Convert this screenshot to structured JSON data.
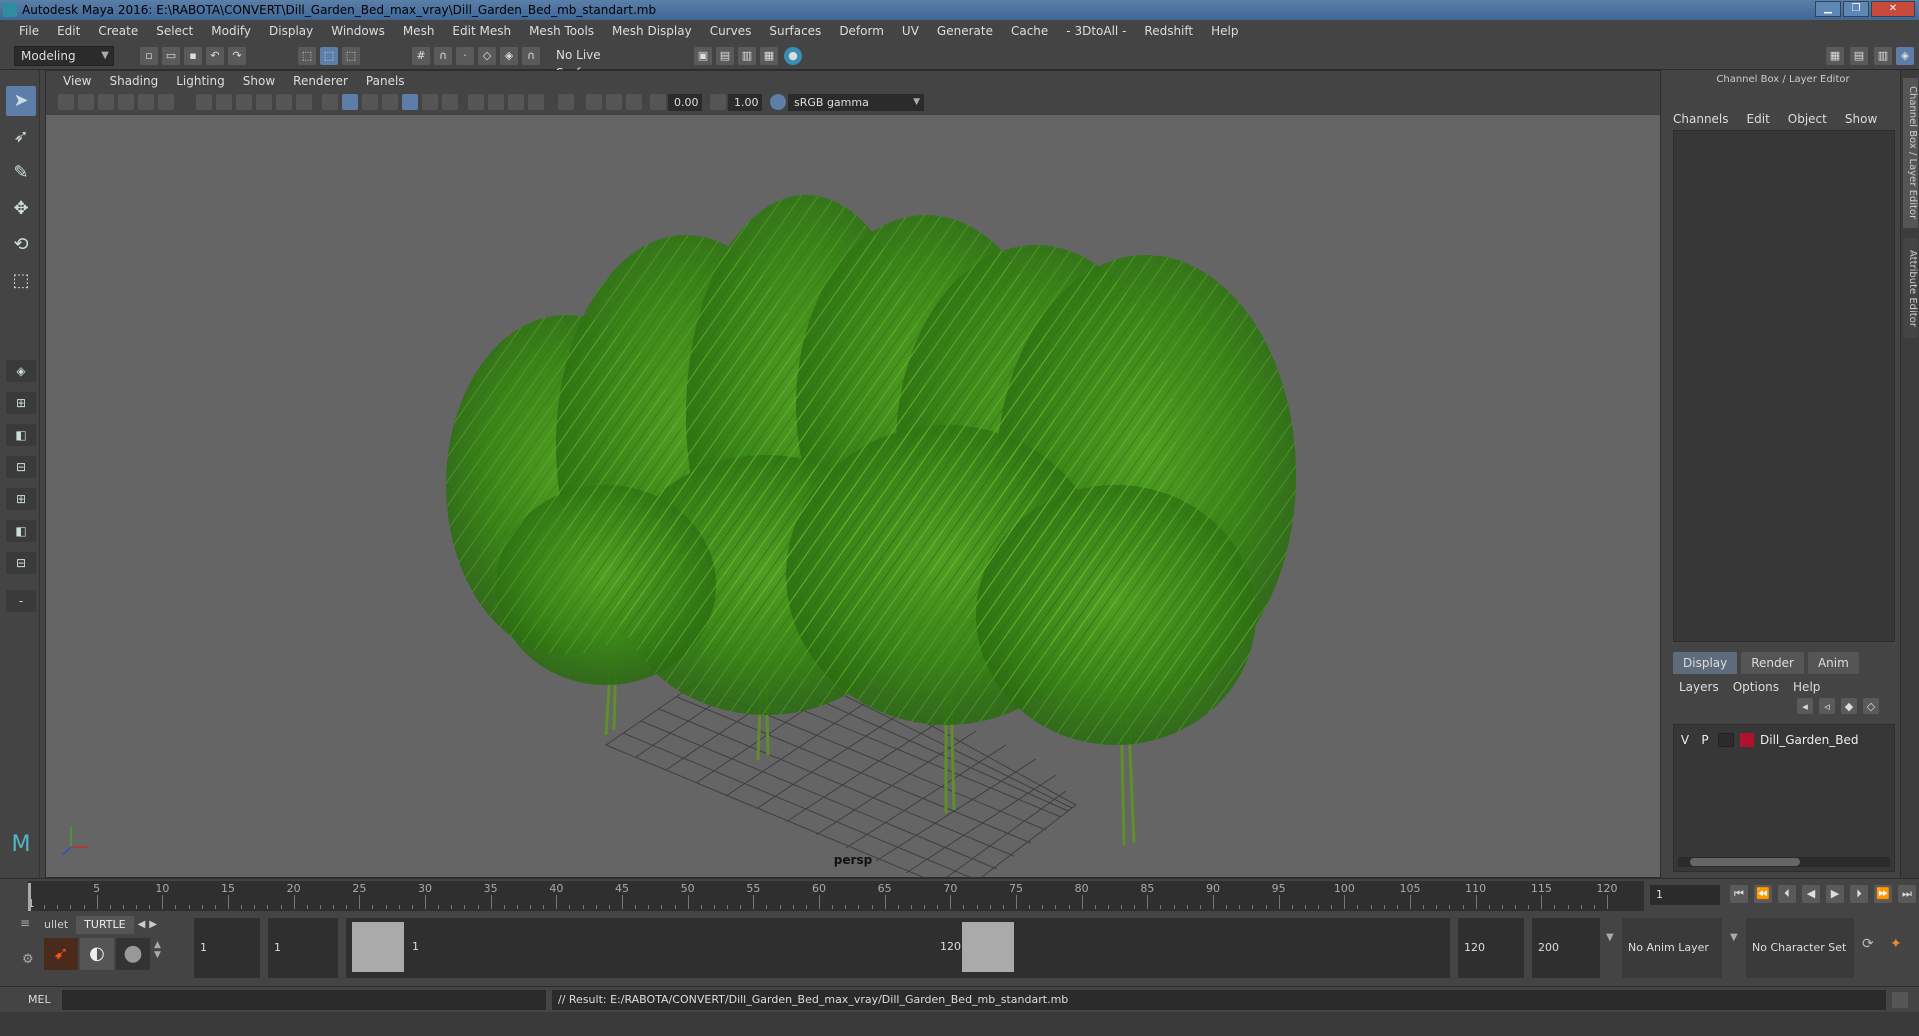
{
  "window": {
    "title": "Autodesk Maya 2016: E:\\RABOTA\\CONVERT\\Dill_Garden_Bed_max_vray\\Dill_Garden_Bed_mb_standart.mb"
  },
  "menubar": {
    "items": [
      "File",
      "Edit",
      "Create",
      "Select",
      "Modify",
      "Display",
      "Windows",
      "Mesh",
      "Edit Mesh",
      "Mesh Tools",
      "Mesh Display",
      "Curves",
      "Surfaces",
      "Deform",
      "UV",
      "Generate",
      "Cache",
      "- 3DtoAll -",
      "Redshift",
      "Help"
    ]
  },
  "status_toolbar": {
    "mode": "Modeling",
    "live_surface": "No Live Surface"
  },
  "viewport": {
    "menu": [
      "View",
      "Shading",
      "Lighting",
      "Show",
      "Renderer",
      "Panels"
    ],
    "exposure": "0.00",
    "gamma": "1.00",
    "color_space": "sRGB gamma",
    "camera_label": "persp"
  },
  "right_panel": {
    "header": "Channel Box / Layer Editor",
    "channel_menu": [
      "Channels",
      "Edit",
      "Object",
      "Show"
    ],
    "layer_tabs": [
      "Display",
      "Render",
      "Anim"
    ],
    "layer_menu": [
      "Layers",
      "Options",
      "Help"
    ],
    "layer": {
      "visible": "V",
      "playback": "P",
      "name": "Dill_Garden_Bed",
      "color": "#b0122e"
    },
    "side_tabs": [
      "Channel Box / Layer Editor",
      "Attribute Editor"
    ]
  },
  "timeline": {
    "ticks": [
      "5",
      "10",
      "15",
      "20",
      "25",
      "30",
      "35",
      "40",
      "45",
      "50",
      "55",
      "60",
      "65",
      "70",
      "75",
      "80",
      "85",
      "90",
      "95",
      "100",
      "105",
      "110",
      "115",
      "120"
    ],
    "current_marker": "1",
    "current_frame": "1"
  },
  "range": {
    "shelf_tabs": [
      "ullet",
      "TURTLE"
    ],
    "start": "1",
    "playback_start": "1",
    "range_start_label": "1",
    "range_end_label": "120",
    "playback_end": "120",
    "end": "200",
    "anim_layer": "No Anim Layer",
    "char_set": "No Character Set"
  },
  "cmdline": {
    "label": "MEL",
    "result": "// Result: E:/RABOTA/CONVERT/Dill_Garden_Bed_max_vray/Dill_Garden_Bed_mb_standart.mb"
  },
  "colors": {
    "accent": "#5d7ea8",
    "viewport_bg": "#656565",
    "foliage": "#3f8f1f"
  }
}
